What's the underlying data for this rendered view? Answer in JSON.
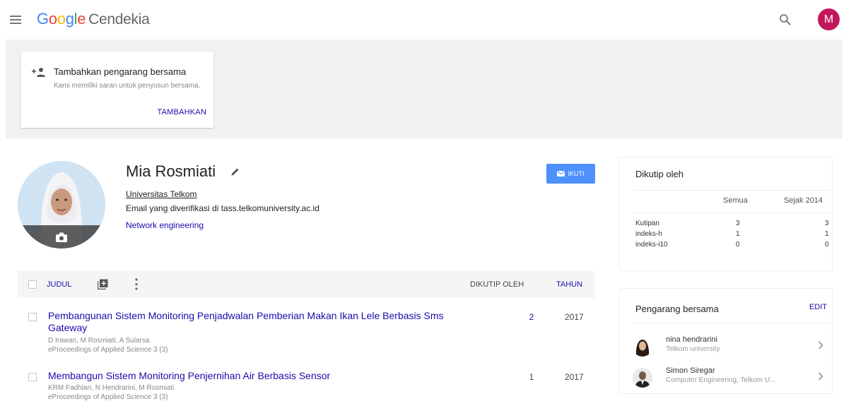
{
  "header": {
    "logo_letters": [
      "G",
      "o",
      "o",
      "g",
      "l",
      "e"
    ],
    "product": "Cendekia",
    "avatar_letter": "M"
  },
  "coauthor_card": {
    "title": "Tambahkan pengarang bersama",
    "description": "Kami memiliki saran untuk penyusun bersama.",
    "button": "TAMBAHKAN"
  },
  "profile": {
    "name": "Mia Rosmiati",
    "affiliation": "Universitas Telkom",
    "email": "Email yang diverifikasi di tass.telkomuniversity.ac.id",
    "interest": "Network engineering",
    "follow_label": "IKUTI"
  },
  "table": {
    "col_title": "JUDUL",
    "col_cited": "DIKUTIP OLEH",
    "col_year": "TAHUN",
    "articles": [
      {
        "title": "Pembangunan Sistem Monitoring Penjadwalan Pemberian Makan Ikan Lele Berbasis Sms Gateway",
        "authors": "D Irawan, M Rosmiati, A Sularsa",
        "publication": "eProceedings of Applied Science 3 (3)",
        "cited": "2",
        "year": "2017"
      },
      {
        "title": "Membangun Sistem Monitoring Penjernihan Air Berbasis Sensor",
        "authors": "KRM Fadhlan, N Hendrarini, M Rosmiati",
        "publication": "eProceedings of Applied Science 3 (3)",
        "cited": "1",
        "year": "2017"
      }
    ]
  },
  "cited_by": {
    "title": "Dikutip oleh",
    "col_all": "Semua",
    "col_since": "Sejak 2014",
    "rows": [
      {
        "label": "Kutipan",
        "all": "3",
        "since": "3"
      },
      {
        "label": "indeks-h",
        "all": "1",
        "since": "1"
      },
      {
        "label": "indeks-i10",
        "all": "0",
        "since": "0"
      }
    ]
  },
  "coauthors": {
    "title": "Pengarang bersama",
    "edit_label": "EDIT",
    "items": [
      {
        "name": "nina hendrarini",
        "affiliation": "Telkom university"
      },
      {
        "name": "Simon Siregar",
        "affiliation": "Computer Engineering, Telkom U..."
      }
    ]
  },
  "colors": {
    "link": "#1a0dab",
    "follow_button": "#4d90fe",
    "avatar": "#c2185b",
    "banner": "#f1f1f1"
  }
}
